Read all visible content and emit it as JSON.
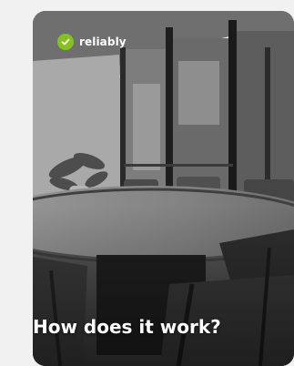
{
  "brand": {
    "name": "reliably",
    "icon": "check-circle-icon",
    "accent_color": "#86c21f"
  },
  "card": {
    "headline": "How does it work?",
    "image": "grayscale-conference-room-photo"
  }
}
